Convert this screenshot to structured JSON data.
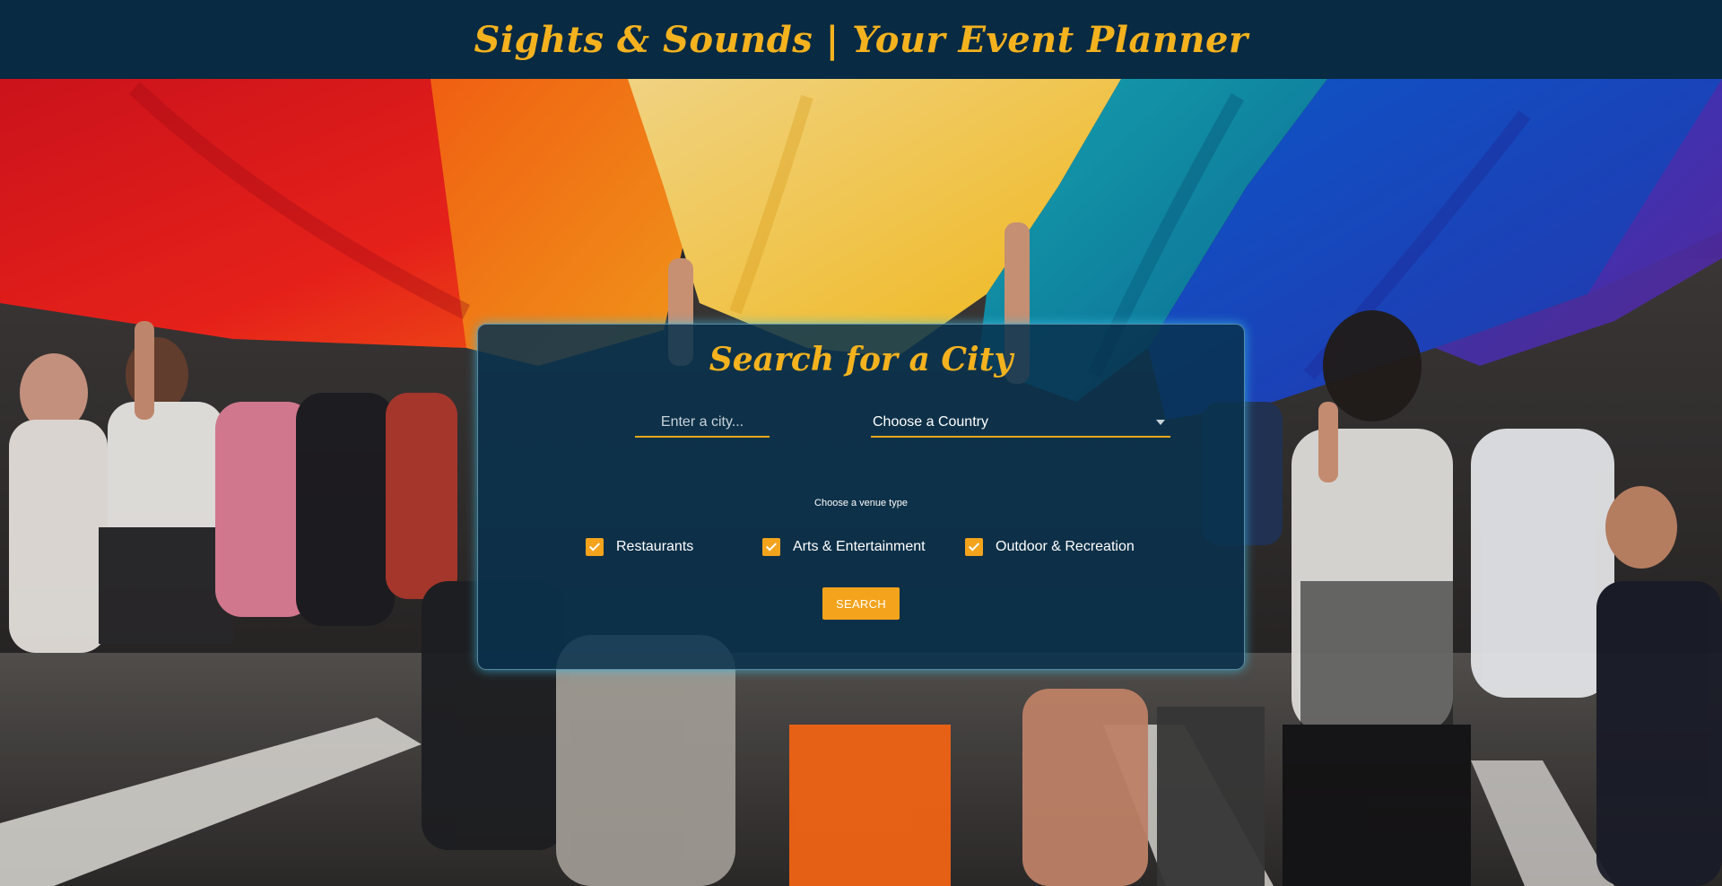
{
  "header": {
    "title": "Sights & Sounds | Your Event Planner"
  },
  "search": {
    "title": "Search for a City",
    "city_placeholder": "Enter a city...",
    "city_value": "",
    "country_selected": "Choose a Country",
    "venue_label": "Choose a venue type",
    "venue_options": [
      {
        "label": "Restaurants",
        "checked": true
      },
      {
        "label": "Arts & Entertainment",
        "checked": true
      },
      {
        "label": "Outdoor & Recreation",
        "checked": true
      }
    ],
    "button_label": "SEARCH"
  },
  "colors": {
    "brand_accent": "#f4b21e",
    "header_background": "#082a42",
    "panel_background": "#08324e",
    "panel_glow": "#3cbee6"
  },
  "icons": {
    "select_arrow": "chevron-down-icon",
    "checkbox_mark": "check-icon"
  }
}
